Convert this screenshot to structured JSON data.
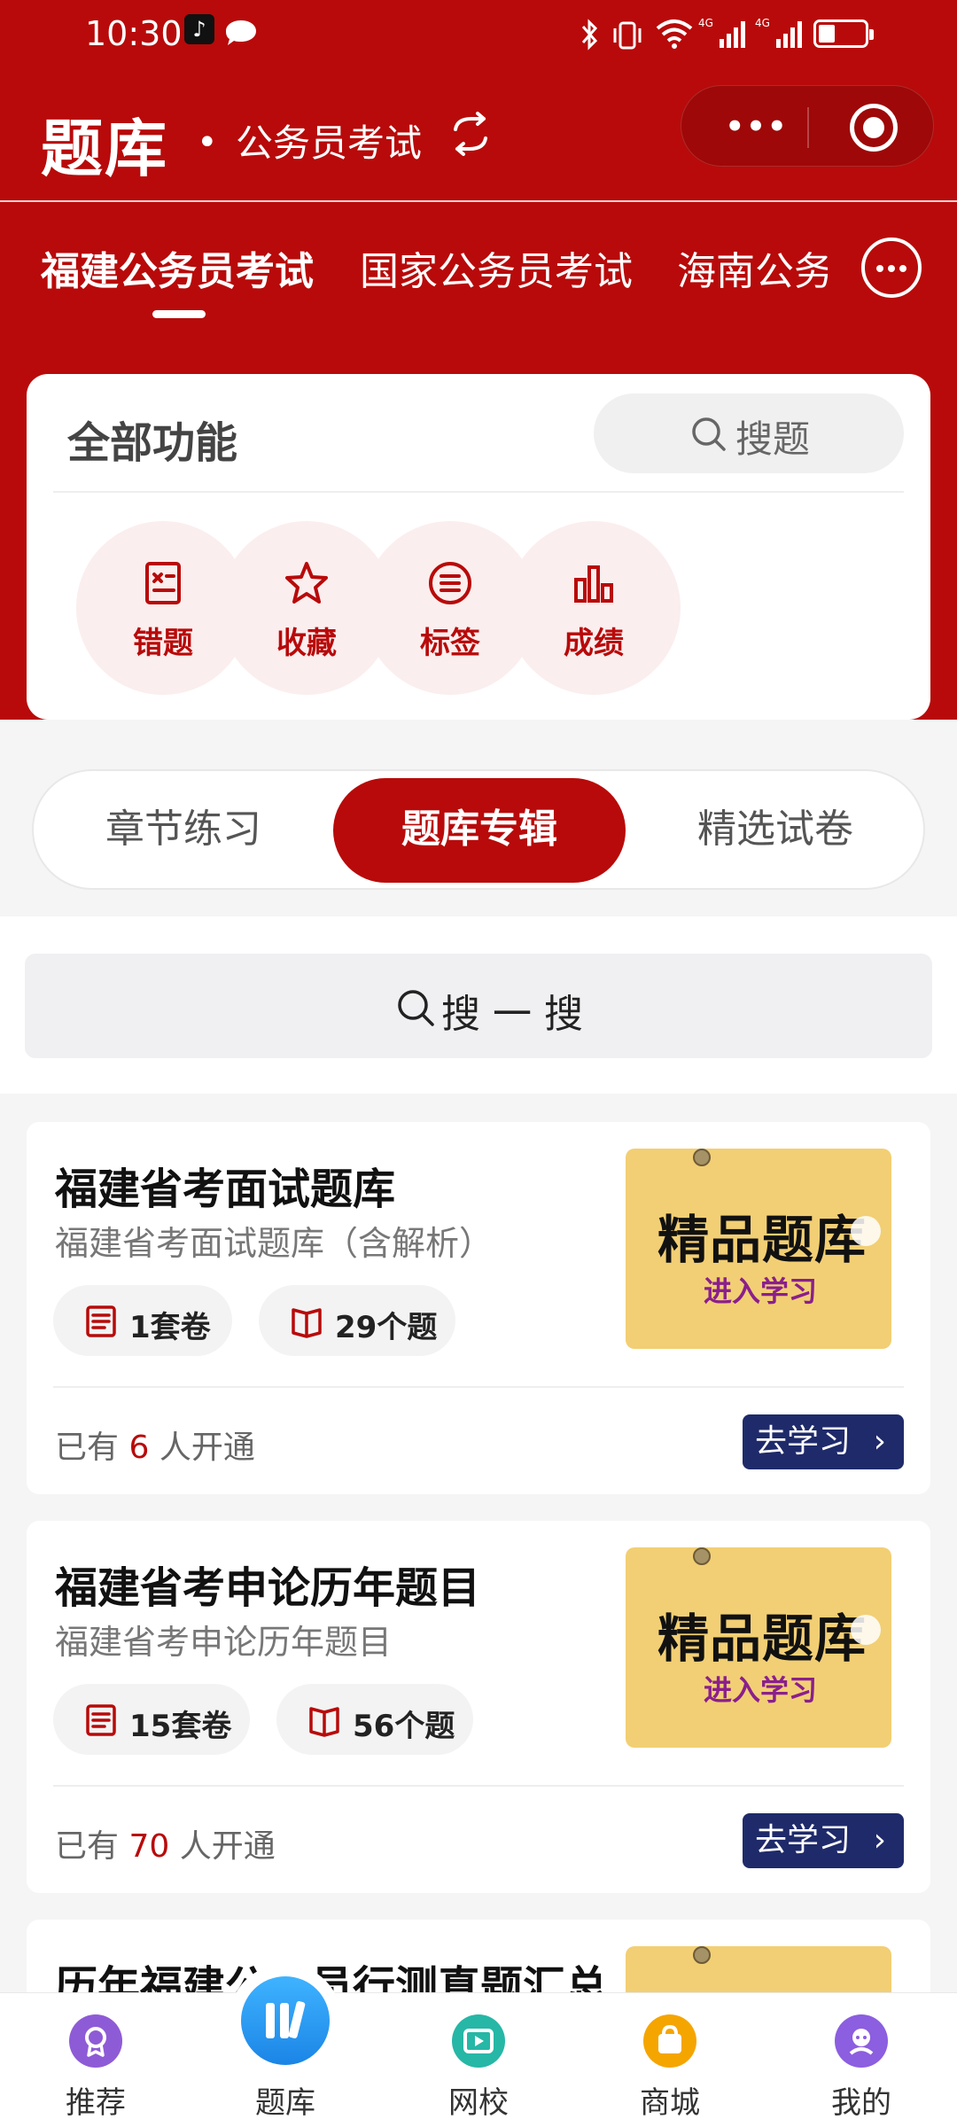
{
  "status_bar": {
    "time": "10:30"
  },
  "header": {
    "title": "题库",
    "dot": "•",
    "subtitle": "公务员考试",
    "capsule_dots": "•••"
  },
  "exam_tabs": [
    {
      "label": "福建公务员考试",
      "active": true
    },
    {
      "label": "国家公务员考试",
      "active": false
    },
    {
      "label": "海南公务员考试",
      "active": false
    }
  ],
  "functions": {
    "title": "全部功能",
    "search_label": "搜题",
    "items": [
      {
        "label": "错题",
        "icon": "wrong-questions-icon"
      },
      {
        "label": "收藏",
        "icon": "star-icon"
      },
      {
        "label": "标签",
        "icon": "tag-list-icon"
      },
      {
        "label": "成绩",
        "icon": "bar-chart-icon"
      }
    ]
  },
  "segments": {
    "items": [
      "章节练习",
      "题库专辑",
      "精选试卷"
    ],
    "selected": "题库专辑"
  },
  "search": {
    "label": "搜一搜"
  },
  "cards": [
    {
      "title": "福建省考面试题库",
      "subtitle": "福建省考面试题库（含解析）",
      "papers": "1套卷",
      "questions": "29个题",
      "count_prefix": "已有",
      "count": "6",
      "count_suffix": "人开通",
      "button": "去学习",
      "thumb_title": "精品题库",
      "thumb_sub": "进入学习"
    },
    {
      "title": "福建省考申论历年题目",
      "subtitle": "福建省考申论历年题目",
      "papers": "15套卷",
      "questions": "56个题",
      "count_prefix": "已有",
      "count": "70",
      "count_suffix": "人开通",
      "button": "去学习",
      "thumb_title": "精品题库",
      "thumb_sub": "进入学习"
    },
    {
      "title": "历年福建公务员行测真题汇总"
    }
  ],
  "bottom_nav": [
    {
      "label": "推荐",
      "color": "#8e5bd6"
    },
    {
      "label": "题库",
      "color": "#1b85e6"
    },
    {
      "label": "网校",
      "color": "#26b7a6"
    },
    {
      "label": "商城",
      "color": "#f5a500"
    },
    {
      "label": "我的",
      "color": "#8c5ee0"
    }
  ],
  "colors": {
    "brand_red": "#b80a0a",
    "button_navy": "#1f2a6a",
    "thumb_yellow": "#f2cf74"
  }
}
